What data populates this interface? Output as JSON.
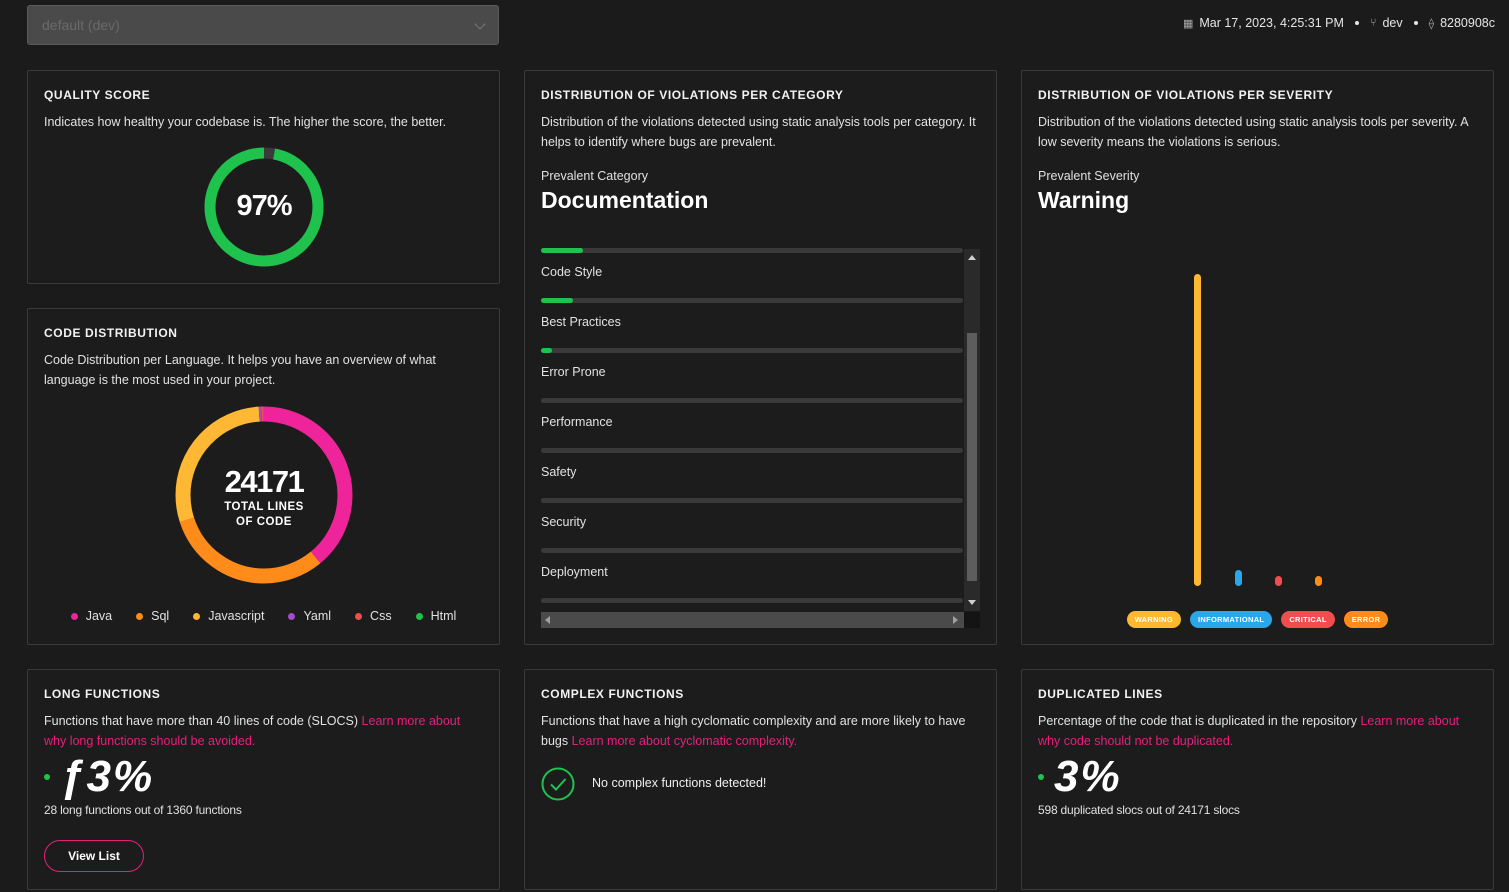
{
  "topbar": {
    "select_value": "default (dev)",
    "date": "Mar 17, 2023, 4:25:31 PM",
    "branch": "dev",
    "commit": "8280908c"
  },
  "quality": {
    "title": "QUALITY SCORE",
    "desc": "Indicates how healthy your codebase is. The higher the score, the better.",
    "score": "97%",
    "score_value": 97,
    "color": "#1ec24d"
  },
  "code": {
    "title": "CODE DISTRIBUTION",
    "desc": "Code Distribution per Language. It helps you have an overview of what language is the most used in your project.",
    "total": "24171",
    "total_label_1": "TOTAL LINES",
    "total_label_2": "OF CODE",
    "languages": [
      {
        "name": "Java",
        "color": "#f0249a",
        "share": 0.39
      },
      {
        "name": "Sql",
        "color": "#ff8c1a",
        "share": 0.31
      },
      {
        "name": "Javascript",
        "color": "#ffb833",
        "share": 0.29
      },
      {
        "name": "Yaml",
        "color": "#a64cc9",
        "share": 0.005
      },
      {
        "name": "Css",
        "color": "#f04e4e",
        "share": 0.004
      },
      {
        "name": "Html",
        "color": "#1ec24d",
        "share": 0.001
      }
    ]
  },
  "category": {
    "title": "DISTRIBUTION OF VIOLATIONS PER CATEGORY",
    "desc": "Distribution of the violations detected using static analysis tools per category. It helps to identify where bugs are prevalent.",
    "prevalent_label": "Prevalent Category",
    "prevalent_value": "Documentation",
    "items": [
      {
        "name": "Code Style",
        "level": 0.1
      },
      {
        "name": "Best Practices",
        "level": 0.075
      },
      {
        "name": "Error Prone",
        "level": 0.025
      },
      {
        "name": "Performance",
        "level": 0
      },
      {
        "name": "Safety",
        "level": 0
      },
      {
        "name": "Security",
        "level": 0
      },
      {
        "name": "Deployment",
        "level": 0
      }
    ]
  },
  "severity": {
    "title": "DISTRIBUTION OF VIOLATIONS PER SEVERITY",
    "desc": "Distribution of the violations detected using static analysis tools per severity. A low severity means the violations is serious.",
    "prevalent_label": "Prevalent Severity",
    "prevalent_value": "Warning",
    "levels": [
      {
        "name": "WARNING",
        "color": "#ffb833",
        "level": 1.0
      },
      {
        "name": "INFORMATIONAL",
        "color": "#2aa7e8",
        "level": 0.05
      },
      {
        "name": "CRITICAL",
        "color": "#f04e4e",
        "level": 0.02
      },
      {
        "name": "ERROR",
        "color": "#ff8c1a",
        "level": 0.02
      }
    ]
  },
  "long": {
    "title": "LONG FUNCTIONS",
    "desc": "Functions that have more than 40 lines of code (SLOCS)",
    "link": "Learn more about why long functions should be avoided.",
    "value": "ƒ3%",
    "sub": "28 long functions out of 1360 functions",
    "button": "View List"
  },
  "complex": {
    "title": "COMPLEX FUNCTIONS",
    "desc": "Functions that have a high cyclomatic complexity and are more likely to have bugs",
    "link": "Learn more about cyclomatic complexity.",
    "message": "No complex functions detected!"
  },
  "dup": {
    "title": "DUPLICATED LINES",
    "desc": "Percentage of the code that is duplicated in the repository",
    "link": "Learn more about why code should not be duplicated.",
    "value": "3%",
    "sub": "598 duplicated slocs out of 24171 slocs"
  }
}
